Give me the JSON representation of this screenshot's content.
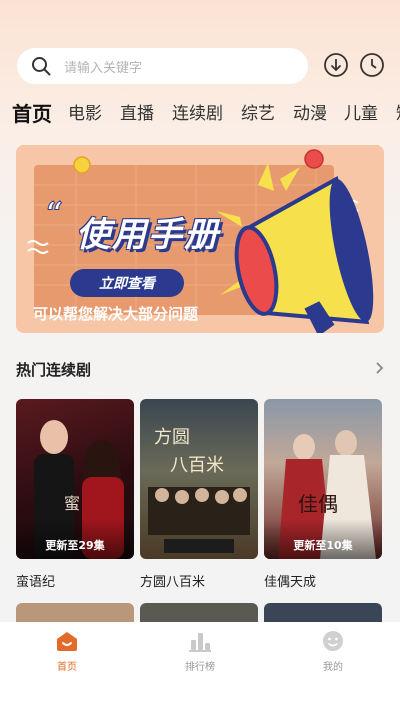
{
  "search": {
    "placeholder": "请输入关键字"
  },
  "header": {
    "download_icon": "download-icon",
    "history_icon": "clock-icon"
  },
  "tabs": [
    {
      "label": "首页",
      "active": true
    },
    {
      "label": "电影"
    },
    {
      "label": "直播"
    },
    {
      "label": "连续剧"
    },
    {
      "label": "综艺"
    },
    {
      "label": "动漫"
    },
    {
      "label": "儿童"
    },
    {
      "label": "短"
    }
  ],
  "banner": {
    "title": "使用手册",
    "button_label": "立即查看",
    "subtitle": "可以帮您解决大部分问题"
  },
  "section": {
    "title": "热门连续剧",
    "more_icon": "chevron-right-icon"
  },
  "cards": [
    {
      "name": "蛮语纪",
      "episode": "更新至29集"
    },
    {
      "name": "方圆八百米",
      "episode": ""
    },
    {
      "name": "佳偶天成",
      "episode": "更新至10集"
    }
  ],
  "bottom_nav": [
    {
      "label": "首页",
      "icon": "home-icon",
      "active": true
    },
    {
      "label": "排行榜",
      "icon": "ranking-icon"
    },
    {
      "label": "我的",
      "icon": "profile-icon"
    }
  ],
  "colors": {
    "accent": "#e46a2a",
    "banner_navy": "#2b3a8f"
  }
}
